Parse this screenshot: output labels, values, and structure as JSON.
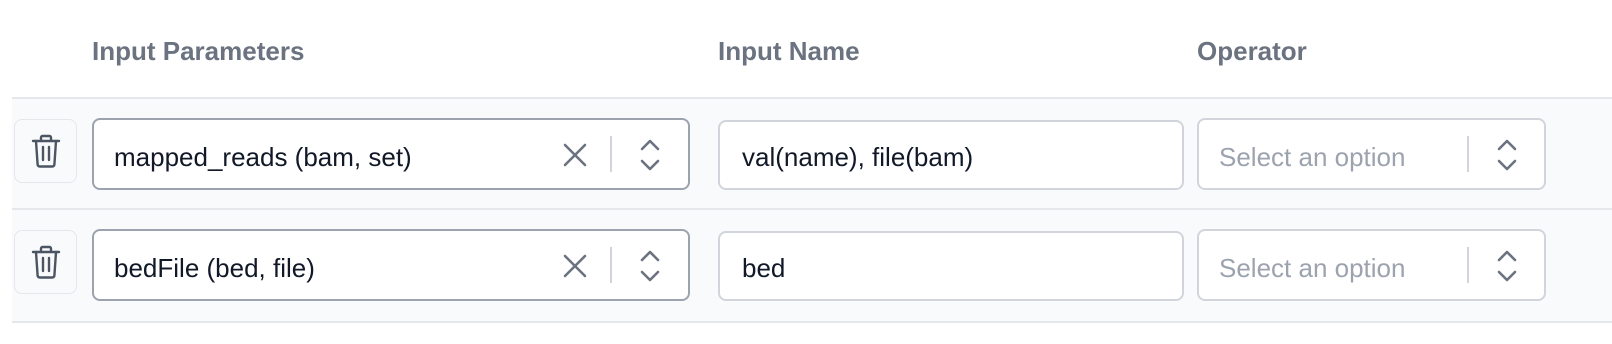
{
  "headers": {
    "input_parameters": "Input Parameters",
    "input_name": "Input Name",
    "operator": "Operator"
  },
  "rows": [
    {
      "parameter": "mapped_reads (bam, set)",
      "input_name": "val(name), file(bam)",
      "operator_placeholder": "Select an option"
    },
    {
      "parameter": "bedFile (bed, file)",
      "input_name": "bed",
      "operator_placeholder": "Select an option"
    }
  ],
  "icons": {
    "delete": "trash-icon",
    "clear": "close-icon",
    "dropdown": "chevron-up-down-icon"
  },
  "colors": {
    "header_text": "#6b7280",
    "row_background": "#f9fafb",
    "placeholder": "#9ca3af",
    "border": "#d1d5db"
  }
}
